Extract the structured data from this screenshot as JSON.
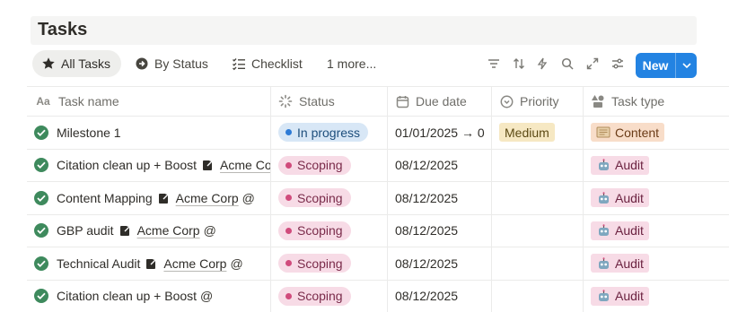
{
  "page": {
    "title": "Tasks"
  },
  "toolbar": {
    "tabs": [
      {
        "label": "All Tasks",
        "icon": "star-icon",
        "active": true
      },
      {
        "label": "By Status",
        "icon": "arrow-circle-icon",
        "active": false
      },
      {
        "label": "Checklist",
        "icon": "checklist-icon",
        "active": false
      }
    ],
    "more_label": "1 more...",
    "tools": [
      "filter-icon",
      "sort-icon",
      "automation-icon",
      "search-icon",
      "expand-icon",
      "settings-icon"
    ],
    "new_label": "New"
  },
  "table": {
    "columns": [
      {
        "label": "Task name",
        "icon": "text-icon"
      },
      {
        "label": "Status",
        "icon": "status-icon"
      },
      {
        "label": "Due date",
        "icon": "calendar-icon"
      },
      {
        "label": "Priority",
        "icon": "priority-icon"
      },
      {
        "label": "Task type",
        "icon": "shapes-icon"
      }
    ],
    "rows": [
      {
        "name": "Milestone 1",
        "mention": "",
        "at": "",
        "status": "In progress",
        "status_color": "blue",
        "due": "01/01/2025 → 0",
        "priority": "Medium",
        "type": "Content",
        "type_color": "orange"
      },
      {
        "name": "Citation clean up + Boost",
        "mention": "Acme Co",
        "at": "",
        "status": "Scoping",
        "status_color": "pink",
        "due": "08/12/2025",
        "priority": "",
        "type": "Audit",
        "type_color": "pink"
      },
      {
        "name": "Content Mapping",
        "mention": "Acme Corp",
        "at": "@",
        "status": "Scoping",
        "status_color": "pink",
        "due": "08/12/2025",
        "priority": "",
        "type": "Audit",
        "type_color": "pink"
      },
      {
        "name": "GBP audit",
        "mention": "Acme Corp",
        "at": "@",
        "status": "Scoping",
        "status_color": "pink",
        "due": "08/12/2025",
        "priority": "",
        "type": "Audit",
        "type_color": "pink"
      },
      {
        "name": "Technical Audit",
        "mention": "Acme Corp",
        "at": "@",
        "status": "Scoping",
        "status_color": "pink",
        "due": "08/12/2025",
        "priority": "",
        "type": "Audit",
        "type_color": "pink"
      },
      {
        "name": "Citation clean up + Boost",
        "mention": "",
        "at": "@",
        "status": "Scoping",
        "status_color": "pink",
        "due": "08/12/2025",
        "priority": "",
        "type": "Audit",
        "type_color": "pink"
      }
    ]
  },
  "colors": {
    "accent": "#2383e2",
    "done_green": "#3e8a5d",
    "status_blue": "#d8e7f6",
    "status_pink": "#f7dbe6",
    "priority_yellow": "#f6e8c3"
  }
}
